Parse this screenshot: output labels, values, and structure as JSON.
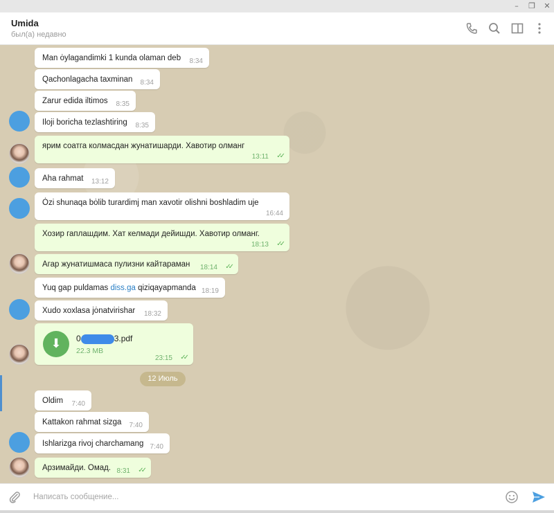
{
  "window": {
    "min_glyph": "–",
    "restore_glyph": "❐",
    "close_glyph": "✕"
  },
  "header": {
    "name": "Umida",
    "status": "был(а) недавно"
  },
  "icons": {
    "phone": "phone-icon",
    "search": "search-icon",
    "sidebar": "sidebar-toggle-icon",
    "more": "more-vertical-icon",
    "attach": "paperclip-icon",
    "emoji": "emoji-icon",
    "send": "send-icon",
    "download": "download-icon"
  },
  "messages": [
    {
      "text": "Man ȯylagandimki 1 kunda olaman deb",
      "time": "8:34",
      "dir": "in"
    },
    {
      "text": "Qachonlagacha taxminan",
      "time": "8:34",
      "dir": "in"
    },
    {
      "text": "Zarur edida iltimos",
      "time": "8:35",
      "dir": "in"
    },
    {
      "text": "Iloji boricha tezlashtiring",
      "time": "8:35",
      "dir": "in"
    },
    {
      "text": "ярим соатга колмасдан жунатишарди. Хавотир олманг",
      "time": "13:11",
      "dir": "out"
    },
    {
      "text": "Aha rahmat",
      "time": "13:12",
      "dir": "in"
    },
    {
      "text": "Ȯzi shunaqa bȯlib turardimj man xavotir olishni boshladim uje",
      "time": "16:44",
      "dir": "in"
    },
    {
      "text": "Хозир гаплашдим. Хат келмади дейишди. Хавотир олманг.",
      "time": "18:13",
      "dir": "out"
    },
    {
      "text": "Агар жунатишмаса пулизни кайтараман",
      "time": "18:14",
      "dir": "out"
    },
    {
      "text_before": "Yuq gap puldamas ",
      "link": "diss.ga",
      "text_after": " qiziqayapmanda",
      "time": "18:19",
      "dir": "in"
    },
    {
      "text": "Xudo xoxlasa jȯnatvirishar",
      "time": "18:32",
      "dir": "in"
    },
    {
      "file_prefix": "0",
      "file_suffix": "3.pdf",
      "size": "22.3 MB",
      "time": "23:15",
      "dir": "out"
    },
    {
      "text": "Oldim",
      "time": "7:40",
      "dir": "in"
    },
    {
      "text": "Kattakon rahmat sizga",
      "time": "7:40",
      "dir": "in"
    },
    {
      "text": "Ishlarizga rivoj charchamang",
      "time": "7:40",
      "dir": "in"
    },
    {
      "text": "Арзимайди. Омад.",
      "time": "8:31",
      "dir": "out"
    }
  ],
  "date_separator": "12 Июль",
  "composer": {
    "placeholder": "Написать сообщение..."
  },
  "colors": {
    "accent": "#4c9fe0",
    "outgoing_bubble": "#effedd",
    "background": "#d7ccb3",
    "read_ticks": "#5db358"
  }
}
